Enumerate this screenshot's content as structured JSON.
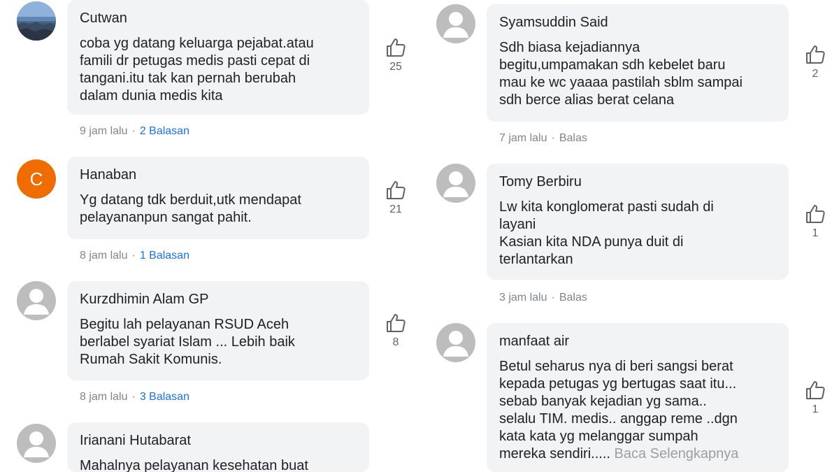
{
  "left_comments": [
    {
      "author": "Cutwan",
      "text": "coba yg datang keluarga pejabat.atau\nfamili dr petugas medis pasti cepat di\ntangani.itu tak kan pernah berubah\ndalam dunia medis kita",
      "likes": "25",
      "time": "9 jam lalu",
      "replies": "2 Balasan",
      "avatar": "photo"
    },
    {
      "author": "Hanaban",
      "text": "Yg datang tdk berduit,utk mendapat\npelayananpun sangat pahit.",
      "likes": "21",
      "time": "8 jam lalu",
      "replies": "1 Balasan",
      "avatar": "letter",
      "avatar_letter": "C"
    },
    {
      "author": "Kurzdhimin Alam GP",
      "text": "Begitu lah pelayanan RSUD Aceh\nberlabel syariat Islam ... Lebih baik\nRumah Sakit Komunis.",
      "likes": "8",
      "time": "8 jam lalu",
      "replies": "3 Balasan",
      "avatar": "default"
    },
    {
      "author": "Irianani Hutabarat",
      "text": "Mahalnya pelayanan kesehatan buat",
      "avatar": "default"
    }
  ],
  "right_comments": [
    {
      "author": "Syamsuddin Said",
      "text": "Sdh biasa kejadiannya\nbegitu,umpamakan sdh kebelet baru\nmau ke wc yaaaa pastilah sblm sampai\nsdh berce alias berat celana",
      "likes": "2",
      "time": "7 jam lalu",
      "reply": "Balas",
      "avatar": "default"
    },
    {
      "author": "Tomy Berbiru",
      "text": "Lw kita konglomerat pasti sudah di\nlayani\nKasian kita NDA punya duit di\nterlantarkan",
      "likes": "1",
      "time": "3 jam lalu",
      "reply": "Balas",
      "avatar": "default"
    },
    {
      "author": "manfaat air",
      "text": "Betul seharus nya di beri sangsi berat\nkepada petugas yg bertugas saat itu...\nsebab banyak kejadian yg sama..\nselalu TIM. medis.. anggap reme ..dgn\nkata kata yg melanggar sumpah\nmereka sendiri.....",
      "read_more": "Baca Selengkapnya",
      "likes": "1",
      "avatar": "default"
    }
  ],
  "meta_separator": "·",
  "icons": {
    "like": "thumbs-up-icon",
    "avatar_default": "person-icon"
  },
  "colors": {
    "bubble": "#f1f3f4",
    "link": "#1a73e8",
    "meta": "#80868b",
    "letter_avatar": "#ef6c00"
  }
}
